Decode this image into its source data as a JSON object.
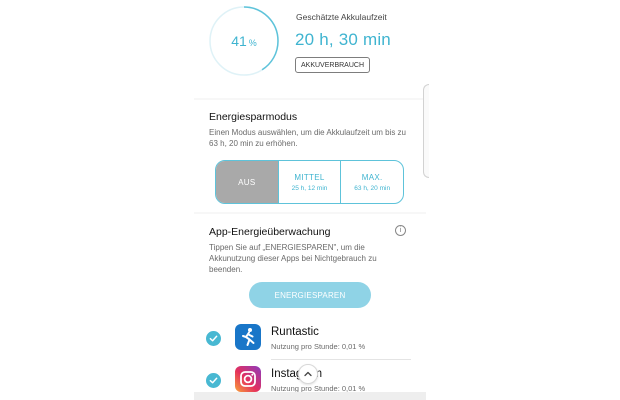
{
  "battery": {
    "percent_value": "41",
    "percent_unit": "%",
    "level_fraction": 0.41,
    "estimate_label": "Geschätzte Akkulaufzeit",
    "estimate_time": "20 h, 30 min",
    "usage_button": "AKKUVERBRAUCH"
  },
  "power_saving": {
    "title": "Energiesparmodus",
    "description": "Einen Modus auswählen, um die Akkulaufzeit um bis zu 63 h, 20 min zu erhöhen.",
    "modes": [
      {
        "label": "AUS",
        "sub": ""
      },
      {
        "label": "MITTEL",
        "sub": "25 h, 12 min"
      },
      {
        "label": "MAX.",
        "sub": "63 h, 20 min"
      }
    ],
    "selected_mode": "AUS"
  },
  "app_monitor": {
    "title": "App-Energieüberwachung",
    "description": "Tippen Sie auf „ENERGIESPAREN\", um die Akkunutzung dieser Apps bei Nichtgebrauch zu beenden.",
    "save_button": "ENERGIESPAREN",
    "apps": [
      {
        "name": "Runtastic",
        "usage": "Nutzung pro Stunde: 0,01 %",
        "checked": true,
        "icon": "runtastic-icon"
      },
      {
        "name": "Instagram",
        "usage": "Nutzung pro Stunde: 0,01 %",
        "checked": true,
        "icon": "instagram-icon"
      }
    ]
  },
  "colors": {
    "accent": "#3fb4d0",
    "button_fill": "#8fd3e6",
    "selected_segment": "#a9a9a9",
    "runtastic": "#1976c8"
  },
  "icons": [
    "info-icon",
    "check-icon",
    "chevron-up-icon",
    "runtastic-icon",
    "instagram-icon"
  ]
}
